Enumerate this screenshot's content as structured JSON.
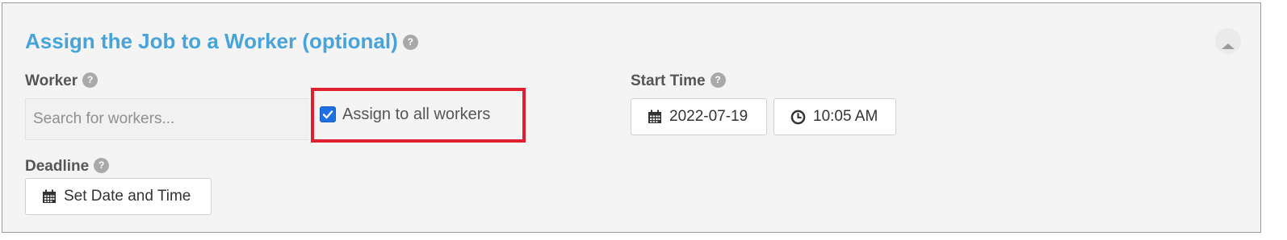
{
  "section": {
    "title": "Assign the Job to a Worker (optional)",
    "help_glyph": "?",
    "collapse_icon": "chevron-up-icon"
  },
  "worker": {
    "label": "Worker",
    "search_placeholder": "Search for workers...",
    "search_value": "",
    "assign_all_label": "Assign to all workers",
    "assign_all_checked": true
  },
  "start_time": {
    "label": "Start Time",
    "date": "2022-07-19",
    "time": "10:05 AM",
    "date_icon": "calendar-icon",
    "time_icon": "clock-icon"
  },
  "deadline": {
    "label": "Deadline",
    "button_label": "Set Date and Time",
    "icon": "calendar-icon"
  },
  "colors": {
    "title": "#47a3d8",
    "label": "#555555",
    "panel_bg": "#f4f4f4",
    "highlight": "#e0202e",
    "checkbox": "#1e6fe0"
  }
}
